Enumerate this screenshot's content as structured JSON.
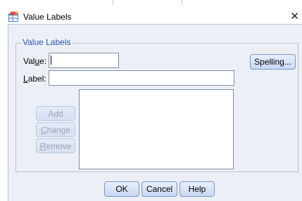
{
  "window": {
    "title": "Value Labels",
    "app_icon": "spss-table-icon",
    "close_glyph": "✕"
  },
  "group": {
    "legend": "Value Labels"
  },
  "value_field": {
    "label_prefix": "Val",
    "label_mnemonic": "u",
    "label_suffix": "e:",
    "value": ""
  },
  "label_field": {
    "label_mnemonic": "L",
    "label_suffix": "abel:",
    "value": ""
  },
  "buttons": {
    "spelling": "Spelling...",
    "add": "Add",
    "change_mnemonic": "C",
    "change_rest": "hange",
    "remove_mnemonic": "R",
    "remove_rest": "emove",
    "ok": "OK",
    "cancel": "Cancel",
    "help": "Help"
  },
  "labels_list": {
    "items": []
  },
  "colors": {
    "legend": "#2a56b4",
    "dialog_bg": "#ecf0f6",
    "button_border": "#7d93c9"
  }
}
